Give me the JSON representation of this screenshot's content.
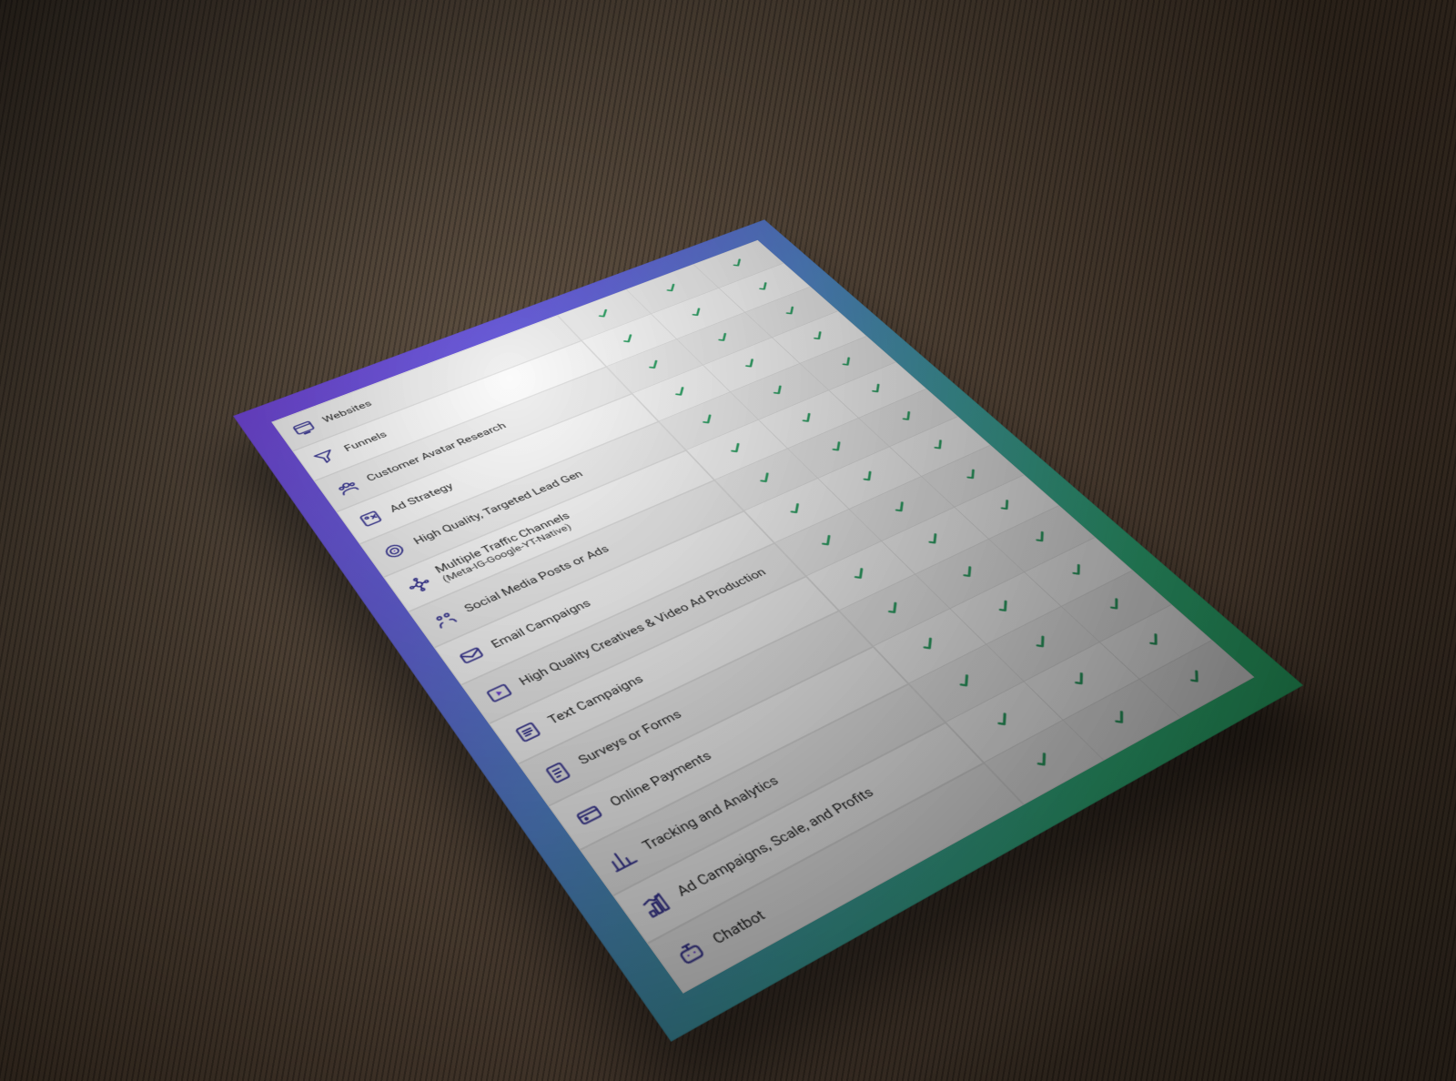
{
  "colors": {
    "gradient_from": "#6b3bdb",
    "gradient_to": "#2fc274",
    "check": "#1f9d5b",
    "icon_stroke": "#2e2b8f"
  },
  "columns": 3,
  "rows": [
    {
      "icon": "website-icon",
      "label": "Websites",
      "checks": [
        true,
        true,
        true
      ]
    },
    {
      "icon": "funnel-icon",
      "label": "Funnels",
      "checks": [
        true,
        true,
        true
      ]
    },
    {
      "icon": "avatar-icon",
      "label": "Customer Avatar Research",
      "checks": [
        true,
        true,
        true
      ]
    },
    {
      "icon": "strategy-icon",
      "label": "Ad Strategy",
      "checks": [
        true,
        true,
        true
      ]
    },
    {
      "icon": "target-icon",
      "label": "High Quality, Targeted Lead Gen",
      "checks": [
        true,
        true,
        true
      ]
    },
    {
      "icon": "channels-icon",
      "label": "Multiple Traffic Channels",
      "sublabel": "(Meta-IG-Google-YT-Native)",
      "checks": [
        true,
        true,
        true
      ]
    },
    {
      "icon": "social-icon",
      "label": "Social Media Posts or Ads",
      "checks": [
        true,
        true,
        true
      ]
    },
    {
      "icon": "email-icon",
      "label": "Email Campaigns",
      "checks": [
        true,
        true,
        true
      ]
    },
    {
      "icon": "video-icon",
      "label": "High Quality Creatives & Video Ad Production",
      "checks": [
        true,
        true,
        true
      ]
    },
    {
      "icon": "text-icon",
      "label": "Text Campaigns",
      "checks": [
        true,
        true,
        true
      ]
    },
    {
      "icon": "survey-icon",
      "label": "Surveys or Forms",
      "checks": [
        true,
        true,
        true
      ]
    },
    {
      "icon": "payment-icon",
      "label": "Online Payments",
      "checks": [
        true,
        true,
        true
      ]
    },
    {
      "icon": "analytics-icon",
      "label": "Tracking and Analytics",
      "checks": [
        true,
        true,
        true
      ]
    },
    {
      "icon": "scale-icon",
      "label": "Ad Campaigns, Scale, and Profits",
      "checks": [
        true,
        true,
        true
      ]
    },
    {
      "icon": "chatbot-icon",
      "label": "Chatbot",
      "checks": [
        true,
        true,
        true
      ]
    }
  ]
}
